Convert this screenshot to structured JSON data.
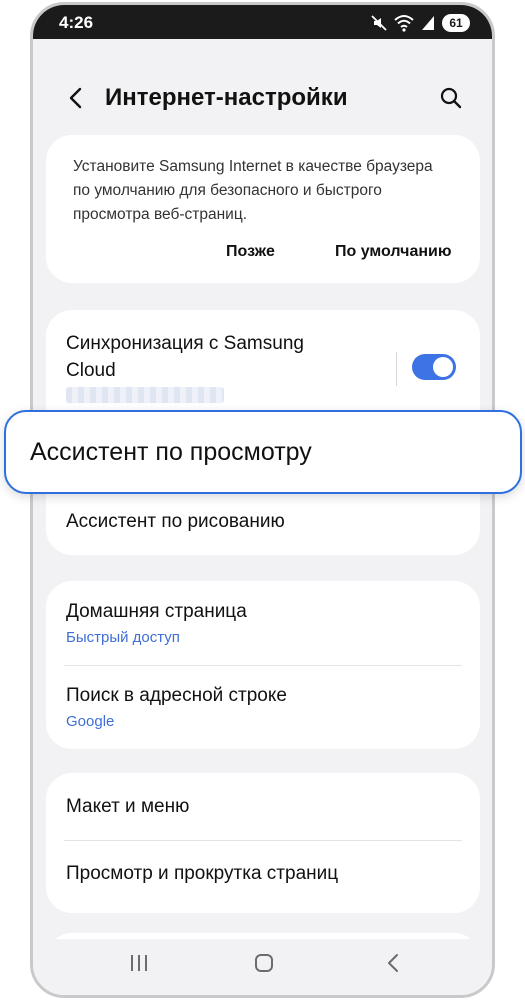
{
  "status": {
    "time": "4:26",
    "battery": "61",
    "icons": [
      "mute-icon",
      "wifi-icon",
      "signal-icon",
      "battery-icon"
    ]
  },
  "appbar": {
    "title": "Интернет-настройки",
    "back_icon": "chevron-left-icon",
    "search_icon": "search-icon"
  },
  "promo": {
    "text": "Установите Samsung Internet в качестве браузера по умолчанию для безопасного и быстрого просмотра веб-страниц.",
    "later_label": "Позже",
    "default_label": "По умолчанию"
  },
  "sync": {
    "title": "Синхронизация с Samsung Cloud",
    "enabled": true
  },
  "highlight": {
    "label": "Ассистент по просмотру"
  },
  "drawing_assistant": {
    "label": "Ассистент по рисованию"
  },
  "group2": [
    {
      "title": "Домашняя страница",
      "subtitle": "Быстрый доступ"
    },
    {
      "title": "Поиск в адресной строке",
      "subtitle": "Google"
    }
  ],
  "group3": [
    {
      "title": "Макет и меню"
    },
    {
      "title": "Просмотр и прокрутка страниц"
    }
  ],
  "colors": {
    "accent": "#3e73e6",
    "highlight_border": "#2f6fe0",
    "subtitle": "#3e6fd6",
    "background": "#f2f2f4"
  }
}
